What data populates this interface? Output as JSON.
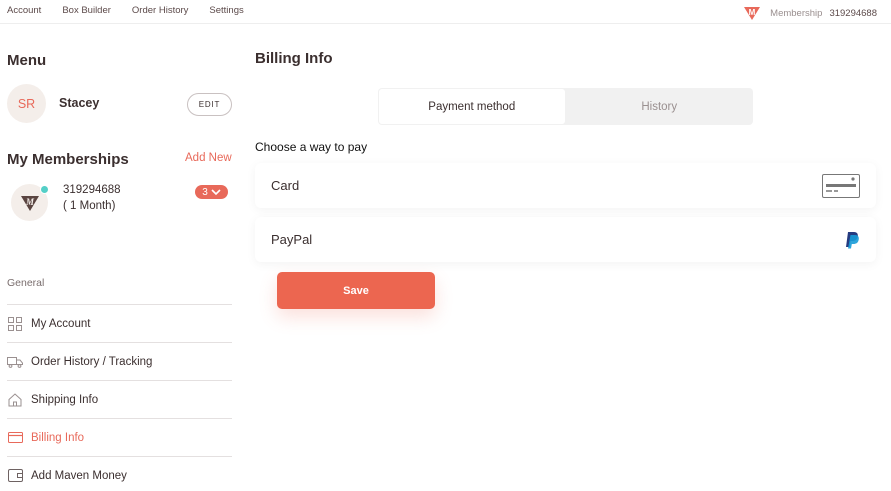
{
  "topnav": {
    "links": [
      "Account",
      "Box Builder",
      "Order History",
      "Settings"
    ],
    "membership_label": "Membership",
    "membership_number": "319294688",
    "logo_letter": "M"
  },
  "sidebar": {
    "menu_title": "Menu",
    "user": {
      "initials": "SR",
      "name": "Stacey",
      "edit_label": "EDIT"
    },
    "memberships_title": "My Memberships",
    "add_new_label": "Add New",
    "membership": {
      "id": "319294688",
      "term": "( 1 Month)",
      "badge_count": "3",
      "avatar_letter": "M"
    },
    "general_label": "General",
    "nav_items": [
      {
        "label": "My Account",
        "icon": "grid-icon",
        "active": false
      },
      {
        "label": "Order History / Tracking",
        "icon": "truck-icon",
        "active": false
      },
      {
        "label": "Shipping Info",
        "icon": "home-icon",
        "active": false
      },
      {
        "label": "Billing Info",
        "icon": "credit-card-icon",
        "active": true
      },
      {
        "label": "Add Maven Money",
        "icon": "wallet-icon",
        "active": false
      }
    ]
  },
  "main": {
    "title": "Billing Info",
    "tabs": [
      {
        "label": "Payment method",
        "active": true
      },
      {
        "label": "History",
        "active": false
      }
    ],
    "choose_label": "Choose a way to pay",
    "options": [
      {
        "label": "Card",
        "icon": "credit-card-icon"
      },
      {
        "label": "PayPal",
        "icon": "paypal-icon"
      }
    ],
    "save_label": "Save"
  },
  "colors": {
    "accent": "#e8695a",
    "save_button": "#ec6650",
    "status_dot": "#54cfc7",
    "paypal_dark": "#253b80",
    "paypal_light": "#179bd7"
  }
}
